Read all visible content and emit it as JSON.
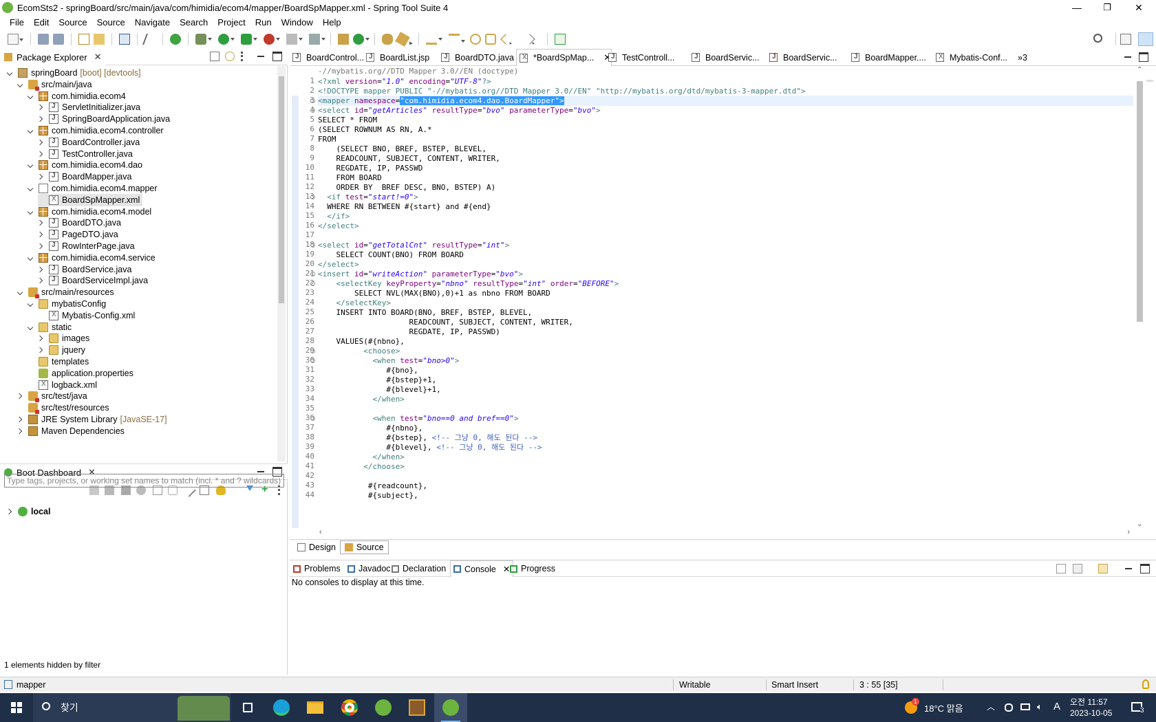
{
  "window": {
    "title": "EcomSts2 - springBoard/src/main/java/com/himidia/ecom4/mapper/BoardSpMapper.xml - Spring Tool Suite 4",
    "minimize": "—",
    "maximize": "❐",
    "close": "✕"
  },
  "menu": [
    "File",
    "Edit",
    "Source",
    "Source",
    "Navigate",
    "Search",
    "Project",
    "Run",
    "Window",
    "Help"
  ],
  "package_explorer": {
    "title": "Package Explorer",
    "close": "✕",
    "items": [
      {
        "label": "springBoard",
        "decor": "[boot] [devtools]",
        "icon": "project-icon",
        "twisty": "open",
        "indent": 0
      },
      {
        "label": "src/main/java",
        "icon": "source-folder-icon",
        "twisty": "open",
        "indent": 1
      },
      {
        "label": "com.himidia.ecom4",
        "icon": "package-icon",
        "twisty": "open",
        "indent": 2
      },
      {
        "label": "ServletInitializer.java",
        "icon": "java-file-icon",
        "twisty": "closed",
        "indent": 3
      },
      {
        "label": "SpringBoardApplication.java",
        "icon": "java-file-icon",
        "twisty": "closed",
        "indent": 3
      },
      {
        "label": "com.himidia.ecom4.controller",
        "icon": "package-icon",
        "twisty": "open",
        "indent": 2
      },
      {
        "label": "BoardController.java",
        "icon": "java-file-icon",
        "twisty": "closed",
        "indent": 3
      },
      {
        "label": "TestController.java",
        "icon": "java-file-icon",
        "twisty": "closed",
        "indent": 3
      },
      {
        "label": "com.himidia.ecom4.dao",
        "icon": "package-icon",
        "twisty": "open",
        "indent": 2
      },
      {
        "label": "BoardMapper.java",
        "icon": "java-file-icon",
        "twisty": "closed",
        "indent": 3
      },
      {
        "label": "com.himidia.ecom4.mapper",
        "icon": "empty-package-icon",
        "twisty": "open",
        "indent": 2
      },
      {
        "label": "BoardSpMapper.xml",
        "icon": "xml-file-icon",
        "twisty": "none",
        "indent": 3,
        "selected": true
      },
      {
        "label": "com.himidia.ecom4.model",
        "icon": "package-icon",
        "twisty": "open",
        "indent": 2
      },
      {
        "label": "BoardDTO.java",
        "icon": "java-file-icon",
        "twisty": "closed",
        "indent": 3
      },
      {
        "label": "PageDTO.java",
        "icon": "java-file-icon",
        "twisty": "closed",
        "indent": 3
      },
      {
        "label": "RowInterPage.java",
        "icon": "java-file-icon",
        "twisty": "closed",
        "indent": 3
      },
      {
        "label": "com.himidia.ecom4.service",
        "icon": "package-icon",
        "twisty": "open",
        "indent": 2
      },
      {
        "label": "BoardService.java",
        "icon": "java-file-icon",
        "twisty": "closed",
        "indent": 3
      },
      {
        "label": "BoardServiceImpl.java",
        "icon": "java-file-icon",
        "twisty": "closed",
        "indent": 3
      },
      {
        "label": "src/main/resources",
        "icon": "resource-folder-icon",
        "twisty": "open",
        "indent": 1
      },
      {
        "label": "mybatisConfig",
        "icon": "folder-icon",
        "twisty": "open",
        "indent": 2
      },
      {
        "label": "Mybatis-Config.xml",
        "icon": "xml-file-icon",
        "twisty": "none",
        "indent": 3
      },
      {
        "label": "static",
        "icon": "folder-icon",
        "twisty": "open",
        "indent": 2
      },
      {
        "label": "images",
        "icon": "folder-icon",
        "twisty": "closed",
        "indent": 3
      },
      {
        "label": "jquery",
        "icon": "folder-icon",
        "twisty": "closed",
        "indent": 3
      },
      {
        "label": "templates",
        "icon": "folder-icon",
        "twisty": "none",
        "indent": 2
      },
      {
        "label": "application.properties",
        "icon": "properties-icon",
        "twisty": "none",
        "indent": 2
      },
      {
        "label": "logback.xml",
        "icon": "xml-file-icon",
        "twisty": "none",
        "indent": 2
      },
      {
        "label": "src/test/java",
        "icon": "source-folder-icon",
        "twisty": "closed",
        "indent": 1
      },
      {
        "label": "src/test/resources",
        "icon": "source-folder-icon",
        "twisty": "none",
        "indent": 1
      },
      {
        "label": "JRE System Library",
        "decor": "[JavaSE-17]",
        "icon": "library-icon",
        "twisty": "closed",
        "indent": 1
      },
      {
        "label": "Maven Dependencies",
        "icon": "library-icon",
        "twisty": "closed",
        "indent": 1
      }
    ]
  },
  "boot_dashboard": {
    "title": "Boot Dashboard",
    "close": "✕",
    "filter_placeholder": "Type tags, projects, or working set names to match (incl. * and ? wildcards)",
    "item": "local",
    "hidden_message": "1 elements hidden by filter"
  },
  "editor_tabs": [
    {
      "label": "BoardControl...",
      "icon": "java-file-icon"
    },
    {
      "label": "BoardList.jsp",
      "icon": "jsp-file-icon"
    },
    {
      "label": "BoardDTO.java",
      "icon": "java-file-icon"
    },
    {
      "label": "*BoardSpMap...",
      "icon": "xml-file-icon",
      "active": true
    },
    {
      "label": "TestControll...",
      "icon": "java-file-icon"
    },
    {
      "label": "BoardServic...",
      "icon": "java-file-icon"
    },
    {
      "label": "BoardServic...",
      "icon": "java-error-file-icon"
    },
    {
      "label": "BoardMapper....",
      "icon": "java-file-icon"
    },
    {
      "label": "Mybatis-Conf...",
      "icon": "xml-file-icon"
    },
    {
      "label": "»3",
      "icon": "overflow-icon"
    }
  ],
  "editor": {
    "header_line": "-//mybatis.org//DTD Mapper 3.0//EN (doctype)",
    "current_line": 3,
    "fold_lines": [
      3,
      4,
      13,
      18,
      21,
      22,
      29,
      30,
      36
    ],
    "lines": [
      "<?xml version=\"1.0\" encoding=\"UTF-8\"?>",
      "<!DOCTYPE mapper PUBLIC \"-//mybatis.org//DTD Mapper 3.0//EN\" \"http://mybatis.org/dtd/mybatis-3-mapper.dtd\">",
      "<mapper namespace=\"com.himidia.ecom4.dao.BoardMapper\">",
      "<select id=\"getArticles\" resultType=\"bvo\" parameterType=\"bvo\">",
      "SELECT * FROM",
      "(SELECT ROWNUM AS RN, A.*",
      "FROM",
      "    (SELECT BNO, BREF, BSTEP, BLEVEL,",
      "    READCOUNT, SUBJECT, CONTENT, WRITER,",
      "    REGDATE, IP, PASSWD",
      "    FROM BOARD",
      "    ORDER BY  BREF DESC, BNO, BSTEP) A)",
      "  <if test=\"start!=0\">",
      "  WHERE RN BETWEEN #{start} and #{end}",
      "  </if>",
      "</select>",
      "",
      "<select id=\"getTotalCnt\" resultType=\"int\">",
      "    SELECT COUNT(BNO) FROM BOARD",
      "</select>",
      "<insert id=\"writeAction\" parameterType=\"bvo\">",
      "    <selectKey keyProperty=\"nbno\" resultType=\"int\" order=\"BEFORE\">",
      "        SELECT NVL(MAX(BNO),0)+1 as nbno FROM BOARD",
      "    </selectKey>",
      "    INSERT INTO BOARD(BNO, BREF, BSTEP, BLEVEL,",
      "                    READCOUNT, SUBJECT, CONTENT, WRITER,",
      "                    REGDATE, IP, PASSWD)",
      "    VALUES(#{nbno},",
      "          <choose>",
      "            <when test=\"bno>0\">",
      "               #{bno},",
      "               #{bstep}+1,",
      "               #{blevel}+1,",
      "            </when>",
      "",
      "            <when test=\"bno==0 and bref==0\">",
      "               #{nbno},",
      "               #{bstep}, <!-- 그냥 0, 해도 된다 -->",
      "               #{blevel}, <!-- 그냥 0, 해도 된다 -->",
      "            </when>",
      "          </choose>",
      "",
      "           #{readcount},",
      "           #{subject},"
    ]
  },
  "design_source_tabs": [
    "Design",
    "Source"
  ],
  "bottom_tabs": [
    {
      "label": "Problems",
      "icon": "problems-icon"
    },
    {
      "label": "Javadoc",
      "icon": "javadoc-icon"
    },
    {
      "label": "Declaration",
      "icon": "declaration-icon"
    },
    {
      "label": "Console",
      "icon": "console-icon",
      "active": true
    },
    {
      "label": "Progress",
      "icon": "progress-icon"
    }
  ],
  "console_message": "No consoles to display at this time.",
  "status_bar": {
    "selection": "mapper",
    "writable": "Writable",
    "insert_mode": "Smart Insert",
    "position": "3 : 55 [35]"
  },
  "taskbar": {
    "search_label": "찾기",
    "weather": "18°C  맑음",
    "time": "오전 11:57",
    "date": "2023-10-05",
    "ime": "A",
    "notifications": "3",
    "weather_badge": "1"
  },
  "colors": {
    "selection": "#3399ff",
    "tag": "#3f7f7f",
    "attribute": "#7f007f",
    "value": "#2a00ff",
    "comment": "#3f5fbf",
    "taskbar": "#1f2f47"
  }
}
